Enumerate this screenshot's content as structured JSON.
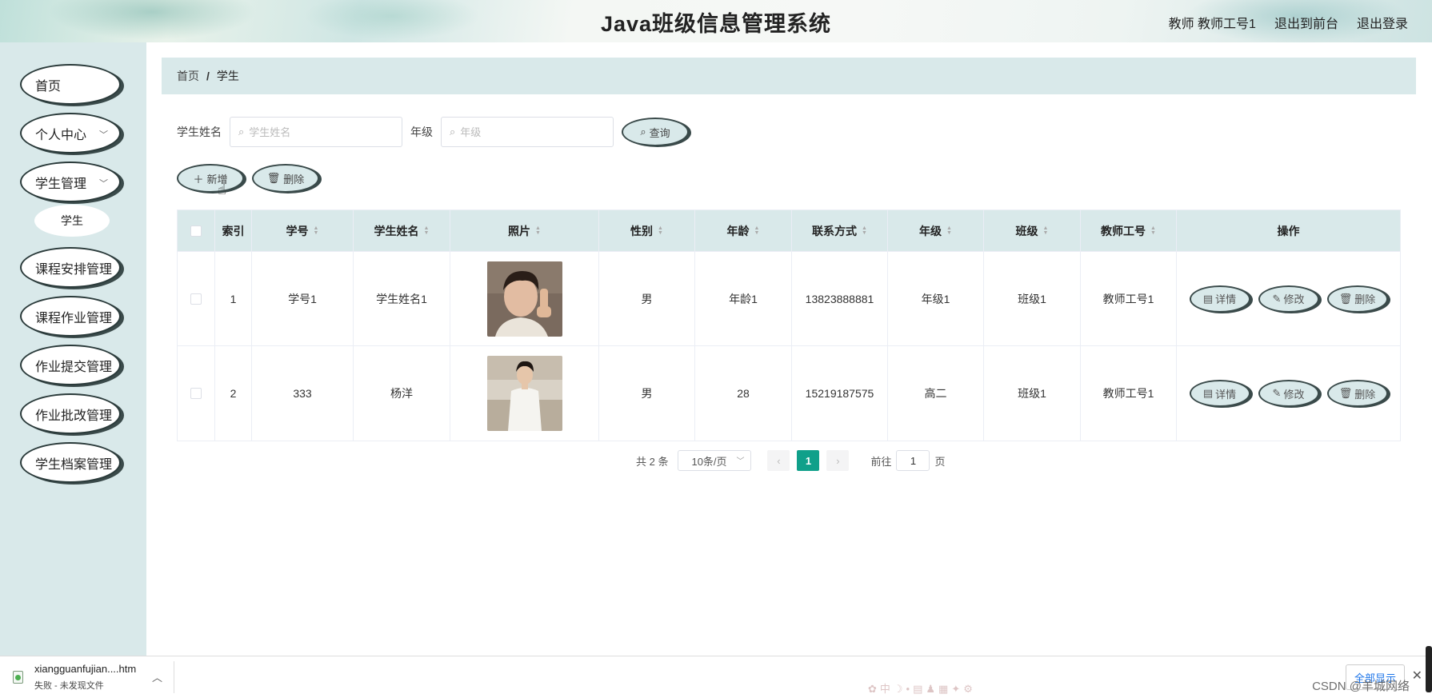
{
  "header": {
    "title": "Java班级信息管理系统",
    "user": "教师 教师工号1",
    "back_front": "退出到前台",
    "logout": "退出登录"
  },
  "sidebar": {
    "items": [
      {
        "label": "首页",
        "has_children": false
      },
      {
        "label": "个人中心",
        "has_children": true
      },
      {
        "label": "学生管理",
        "has_children": true
      },
      {
        "label": "课程安排管理",
        "has_children": false
      },
      {
        "label": "课程作业管理",
        "has_children": false
      },
      {
        "label": "作业提交管理",
        "has_children": false
      },
      {
        "label": "作业批改管理",
        "has_children": false
      },
      {
        "label": "学生档案管理",
        "has_children": false
      }
    ],
    "sub_item": "学生"
  },
  "breadcrumb": {
    "home": "首页",
    "sep": "/",
    "current": "学生"
  },
  "search": {
    "name_label": "学生姓名",
    "name_placeholder": "学生姓名",
    "grade_label": "年级",
    "grade_placeholder": "年级",
    "query_button": "查询"
  },
  "actions": {
    "add": "新增",
    "delete": "删除"
  },
  "table": {
    "headers": {
      "index": "索引",
      "student_no": "学号",
      "name": "学生姓名",
      "photo": "照片",
      "gender": "性别",
      "age": "年龄",
      "contact": "联系方式",
      "grade": "年级",
      "class": "班级",
      "teacher_no": "教师工号",
      "ops": "操作"
    },
    "rows": [
      {
        "index": "1",
        "student_no": "学号1",
        "name": "学生姓名1",
        "gender": "男",
        "age": "年龄1",
        "contact": "13823888881",
        "grade": "年级1",
        "class": "班级1",
        "teacher_no": "教师工号1"
      },
      {
        "index": "2",
        "student_no": "333",
        "name": "杨洋",
        "gender": "男",
        "age": "28",
        "contact": "15219187575",
        "grade": "高二",
        "class": "班级1",
        "teacher_no": "教师工号1"
      }
    ],
    "op_labels": {
      "detail": "详情",
      "edit": "修改",
      "delete": "删除"
    }
  },
  "pagination": {
    "total": "共 2 条",
    "page_size": "10条/页",
    "current_page": "1",
    "goto_prefix": "前往",
    "goto_value": "1",
    "goto_suffix": "页"
  },
  "download_bar": {
    "filename": "xiangguanfujian....htm",
    "status": "失败 - 未发现文件",
    "show_all": "全部显示",
    "watermark": "CSDN @羊城网络"
  },
  "colors": {
    "accent": "#d9e9ea",
    "active_page": "#10a08a",
    "border": "#3a4a4a"
  }
}
